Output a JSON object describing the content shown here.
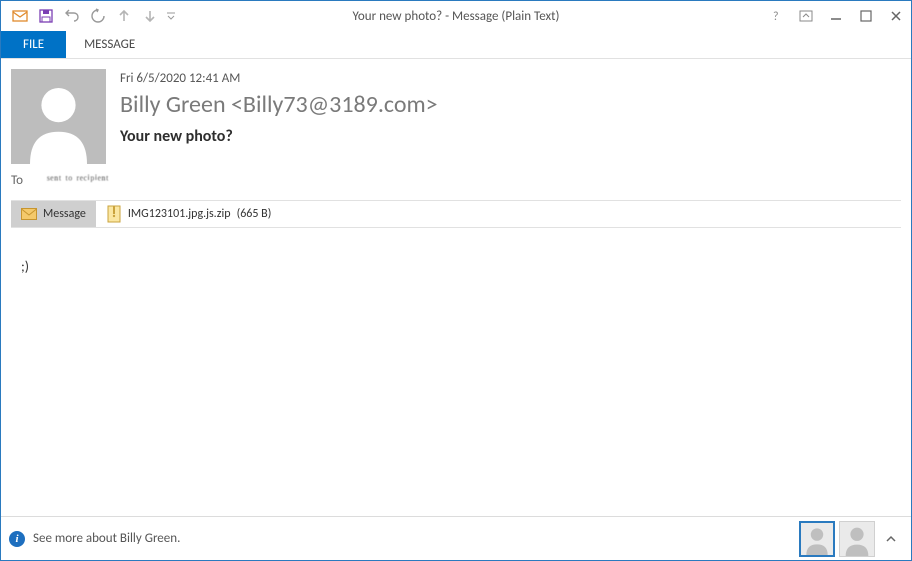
{
  "window": {
    "title": "Your new photo? - Message (Plain Text)"
  },
  "tabs": {
    "file": "FILE",
    "message": "MESSAGE"
  },
  "email": {
    "date": "Fri 6/5/2020 12:41 AM",
    "sender": "Billy Green <Billy73@3189.com>",
    "subject": "Your new photo?",
    "to_label": "To",
    "to_value": "ˢᵉⁿᵗ ᵗᵒ ʳᵉᶜⁱᵖⁱᵉⁿᵗ"
  },
  "attach": {
    "tab_label": "Message",
    "item_name": "IMG123101.jpg.js.zip",
    "item_size": "(665 B)"
  },
  "body": {
    "text": ";)"
  },
  "footer": {
    "info_text": "See more about Billy Green."
  }
}
